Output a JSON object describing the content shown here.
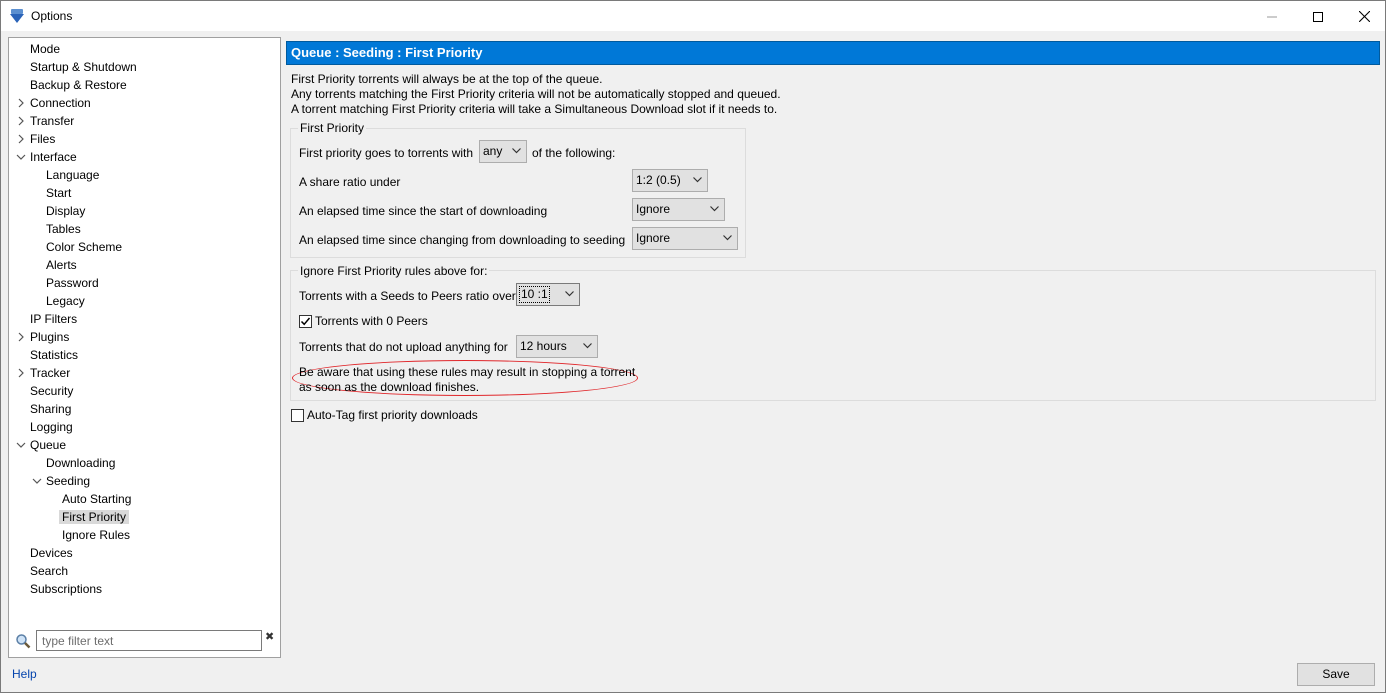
{
  "window": {
    "title": "Options",
    "minimize": "—",
    "maximize": "☐",
    "close": "✕"
  },
  "tree": [
    {
      "label": "Mode",
      "level": 0,
      "expander": "none"
    },
    {
      "label": "Startup & Shutdown",
      "level": 0,
      "expander": "none"
    },
    {
      "label": "Backup & Restore",
      "level": 0,
      "expander": "none"
    },
    {
      "label": "Connection",
      "level": 0,
      "expander": "collapsed"
    },
    {
      "label": "Transfer",
      "level": 0,
      "expander": "collapsed"
    },
    {
      "label": "Files",
      "level": 0,
      "expander": "collapsed"
    },
    {
      "label": "Interface",
      "level": 0,
      "expander": "expanded"
    },
    {
      "label": "Language",
      "level": 1,
      "expander": "none"
    },
    {
      "label": "Start",
      "level": 1,
      "expander": "none"
    },
    {
      "label": "Display",
      "level": 1,
      "expander": "none"
    },
    {
      "label": "Tables",
      "level": 1,
      "expander": "none"
    },
    {
      "label": "Color Scheme",
      "level": 1,
      "expander": "none"
    },
    {
      "label": "Alerts",
      "level": 1,
      "expander": "none"
    },
    {
      "label": "Password",
      "level": 1,
      "expander": "none"
    },
    {
      "label": "Legacy",
      "level": 1,
      "expander": "none"
    },
    {
      "label": "IP Filters",
      "level": 0,
      "expander": "none"
    },
    {
      "label": "Plugins",
      "level": 0,
      "expander": "collapsed"
    },
    {
      "label": "Statistics",
      "level": 0,
      "expander": "none"
    },
    {
      "label": "Tracker",
      "level": 0,
      "expander": "collapsed"
    },
    {
      "label": "Security",
      "level": 0,
      "expander": "none"
    },
    {
      "label": "Sharing",
      "level": 0,
      "expander": "none"
    },
    {
      "label": "Logging",
      "level": 0,
      "expander": "none"
    },
    {
      "label": "Queue",
      "level": 0,
      "expander": "expanded"
    },
    {
      "label": "Downloading",
      "level": 1,
      "expander": "none"
    },
    {
      "label": "Seeding",
      "level": 1,
      "expander": "expanded"
    },
    {
      "label": "Auto Starting",
      "level": 2,
      "expander": "none"
    },
    {
      "label": "First Priority",
      "level": 2,
      "expander": "none",
      "selected": true
    },
    {
      "label": "Ignore Rules",
      "level": 2,
      "expander": "none"
    },
    {
      "label": "Devices",
      "level": 0,
      "expander": "none"
    },
    {
      "label": "Search",
      "level": 0,
      "expander": "none"
    },
    {
      "label": "Subscriptions",
      "level": 0,
      "expander": "none"
    }
  ],
  "filter": {
    "placeholder": "type filter text",
    "value": "",
    "clear": "✖"
  },
  "header": {
    "title": "Queue : Seeding : First Priority"
  },
  "description": [
    "First Priority torrents will always be at the top of the queue.",
    "Any torrents matching the First Priority criteria will not be automatically stopped and queued.",
    "A torrent matching First Priority criteria will take a Simultaneous Download slot if it needs to."
  ],
  "first_priority": {
    "legend": "First Priority",
    "goes_to_prefix": "First priority goes to torrents with",
    "match_value": "any",
    "goes_to_suffix": "of the following:",
    "share_ratio_label": "A share ratio under",
    "share_ratio_value": "1:2 (0.5)",
    "elapsed_download_label": "An elapsed time since the start of downloading",
    "elapsed_download_value": "Ignore",
    "elapsed_seeding_label": "An elapsed time since changing from downloading to seeding",
    "elapsed_seeding_value": "Ignore"
  },
  "ignore_rules": {
    "legend": "Ignore First Priority rules above for:",
    "seeds_peers_label": "Torrents with a Seeds to Peers ratio over",
    "seeds_peers_value": "10 :1",
    "zero_peers_label": "Torrents with 0 Peers",
    "zero_peers_checked": true,
    "no_upload_label": "Torrents that do not upload anything for",
    "no_upload_value": "12 hours",
    "warning_line1": "Be aware that using these rules may result in stopping a torrent",
    "warning_line2": "as soon as the download finishes."
  },
  "auto_tag": {
    "label": "Auto-Tag first priority downloads",
    "checked": false
  },
  "footer": {
    "help": "Help",
    "save": "Save"
  },
  "colors": {
    "header_bg": "#0078d7",
    "warning_outline": "#e0262a",
    "link": "#0645ad"
  }
}
